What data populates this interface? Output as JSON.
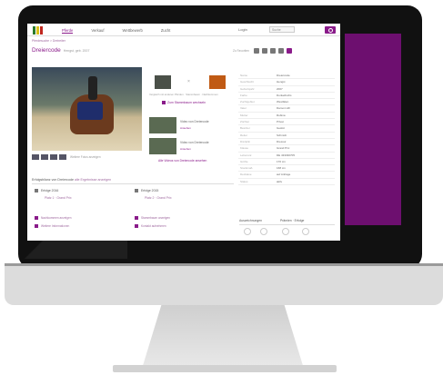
{
  "colors": {
    "brand": "#8a1b8a",
    "promo": "#6d0f6f",
    "bezel": "#111111"
  },
  "logo": {
    "stripe_colors": [
      "#2a7a2a",
      "#d9c01a",
      "#c0271f"
    ]
  },
  "nav": {
    "items": [
      {
        "label": "Pferde",
        "active": true
      },
      {
        "label": "Verkauf"
      },
      {
        "label": "Wettbewerb"
      },
      {
        "label": "Zucht"
      }
    ]
  },
  "header": {
    "lang": "Login",
    "button": "Suche"
  },
  "breadcrumb": "Pferdesuche > Dreireiter",
  "page": {
    "title": "Dreiercode",
    "subtitle": "Hengst, geb. 2007"
  },
  "actions": {
    "label": "Zu Favoriten"
  },
  "media": {
    "caption": "Foto: Pferde",
    "thumbs_caption": "Weitere Fotos anzeigen",
    "compare_caption": "Vergleich mit anderen Pferden · Stammbaum · Nachkommen",
    "compare_link": "Zum Stammbaum wechseln",
    "videos": [
      {
        "title": "Video von Dreiercode",
        "tag": "Ansehen"
      },
      {
        "title": "Video von Dreiercode",
        "tag": "Ansehen"
      }
    ],
    "more_link": "Alle Videos von Dreiercode ansehen"
  },
  "info": {
    "rows": [
      {
        "k": "Name",
        "v": "Dreiercode"
      },
      {
        "k": "Geschlecht",
        "v": "Hengst"
      },
      {
        "k": "Geburtsjahr",
        "v": "2007"
      },
      {
        "k": "Farbe",
        "v": "Dunkelfuchs"
      },
      {
        "k": "Zuchtgebiet",
        "v": "Westfalen"
      },
      {
        "k": "Vater",
        "v": "Damon Hill"
      },
      {
        "k": "Mutter",
        "v": "Rubina"
      },
      {
        "k": "Züchter",
        "v": "Privat"
      },
      {
        "k": "Besitzer",
        "v": "Gestüt"
      },
      {
        "k": "Reiter",
        "v": "Schmidt"
      },
      {
        "k": "Disziplin",
        "v": "Dressur"
      },
      {
        "k": "Klasse",
        "v": "Grand Prix"
      },
      {
        "k": "Lebensnr.",
        "v": "DE 433330705"
      },
      {
        "k": "Größe",
        "v": "170 cm"
      },
      {
        "k": "Stockmaß",
        "v": "168 cm"
      },
      {
        "k": "Decktaxe",
        "v": "auf Anfrage"
      },
      {
        "k": "Status",
        "v": "aktiv"
      }
    ]
  },
  "section": {
    "title": "Erfolgsbilanz von Dreiercode",
    "link": "alle Ergebnisse anzeigen"
  },
  "groups": [
    {
      "title": "Erfolge 2016",
      "detail": "Platz 1 · Grand Prix"
    },
    {
      "title": "Erfolge 2015",
      "detail": "Platz 2 · Grand Prix"
    }
  ],
  "small_links": [
    "Nachkommen anzeigen",
    "Stammbaum anzeigen",
    "Weitere Informationen",
    "Kontakt aufnehmen"
  ],
  "awards": {
    "head": "Auszeichnungen",
    "head2": "Prämien · Erfolge"
  }
}
